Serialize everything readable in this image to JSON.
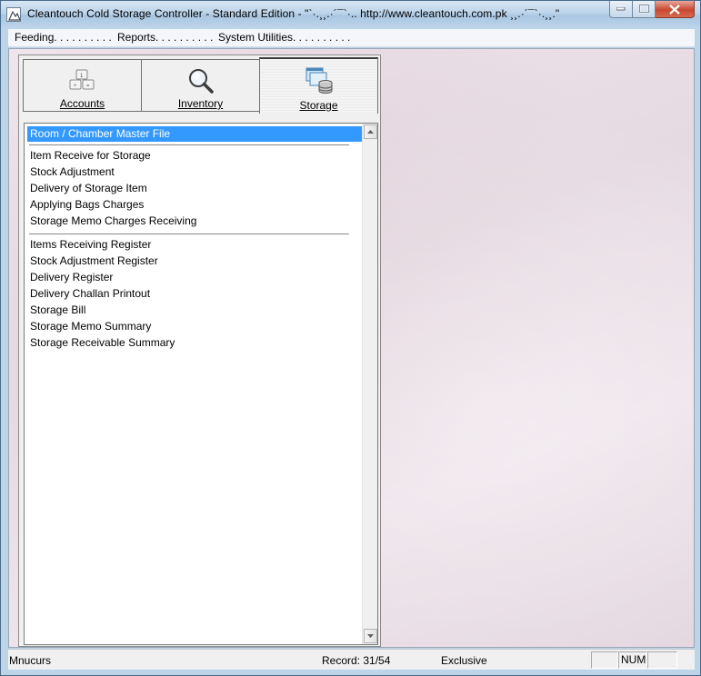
{
  "window": {
    "title": "Cleantouch Cold Storage Controller - Standard Edition  -  \"`·.¸¸.·´¯`·.. http://www.cleantouch.com.pk ¸¸.·´¯`·.¸¸.\""
  },
  "menu": {
    "items": [
      {
        "label": "Feeding. . . . . . . . . ."
      },
      {
        "label": "Reports. . . . . . . . . ."
      },
      {
        "label": "System Utilities. . . . . . . . . ."
      }
    ]
  },
  "tabs": [
    {
      "label": "Accounts",
      "icon": "accounts-icon",
      "active": false
    },
    {
      "label": "Inventory",
      "icon": "magnifier-icon",
      "active": false
    },
    {
      "label": "Storage",
      "icon": "storage-database-icon",
      "active": true
    }
  ],
  "list": {
    "groups": [
      [
        "Room / Chamber Master File"
      ],
      [
        "Item Receive for Storage",
        "Stock Adjustment",
        "Delivery of Storage Item",
        "Applying Bags Charges",
        "Storage Memo Charges Receiving"
      ],
      [
        "Items Receiving Register",
        "Stock Adjustment Register",
        "Delivery Register",
        "Delivery Challan Printout",
        "Storage Bill",
        "Storage Memo Summary",
        "Storage Receivable Summary"
      ]
    ],
    "selected": "Room / Chamber Master File"
  },
  "status": {
    "user": "Mnucurs",
    "record": "Record: 31/54",
    "mode": "Exclusive",
    "num": "NUM",
    "caps": ""
  },
  "colors": {
    "selection": "#3399ff",
    "titlebar": "#bcd4ea",
    "close_button": "#c8482f"
  }
}
